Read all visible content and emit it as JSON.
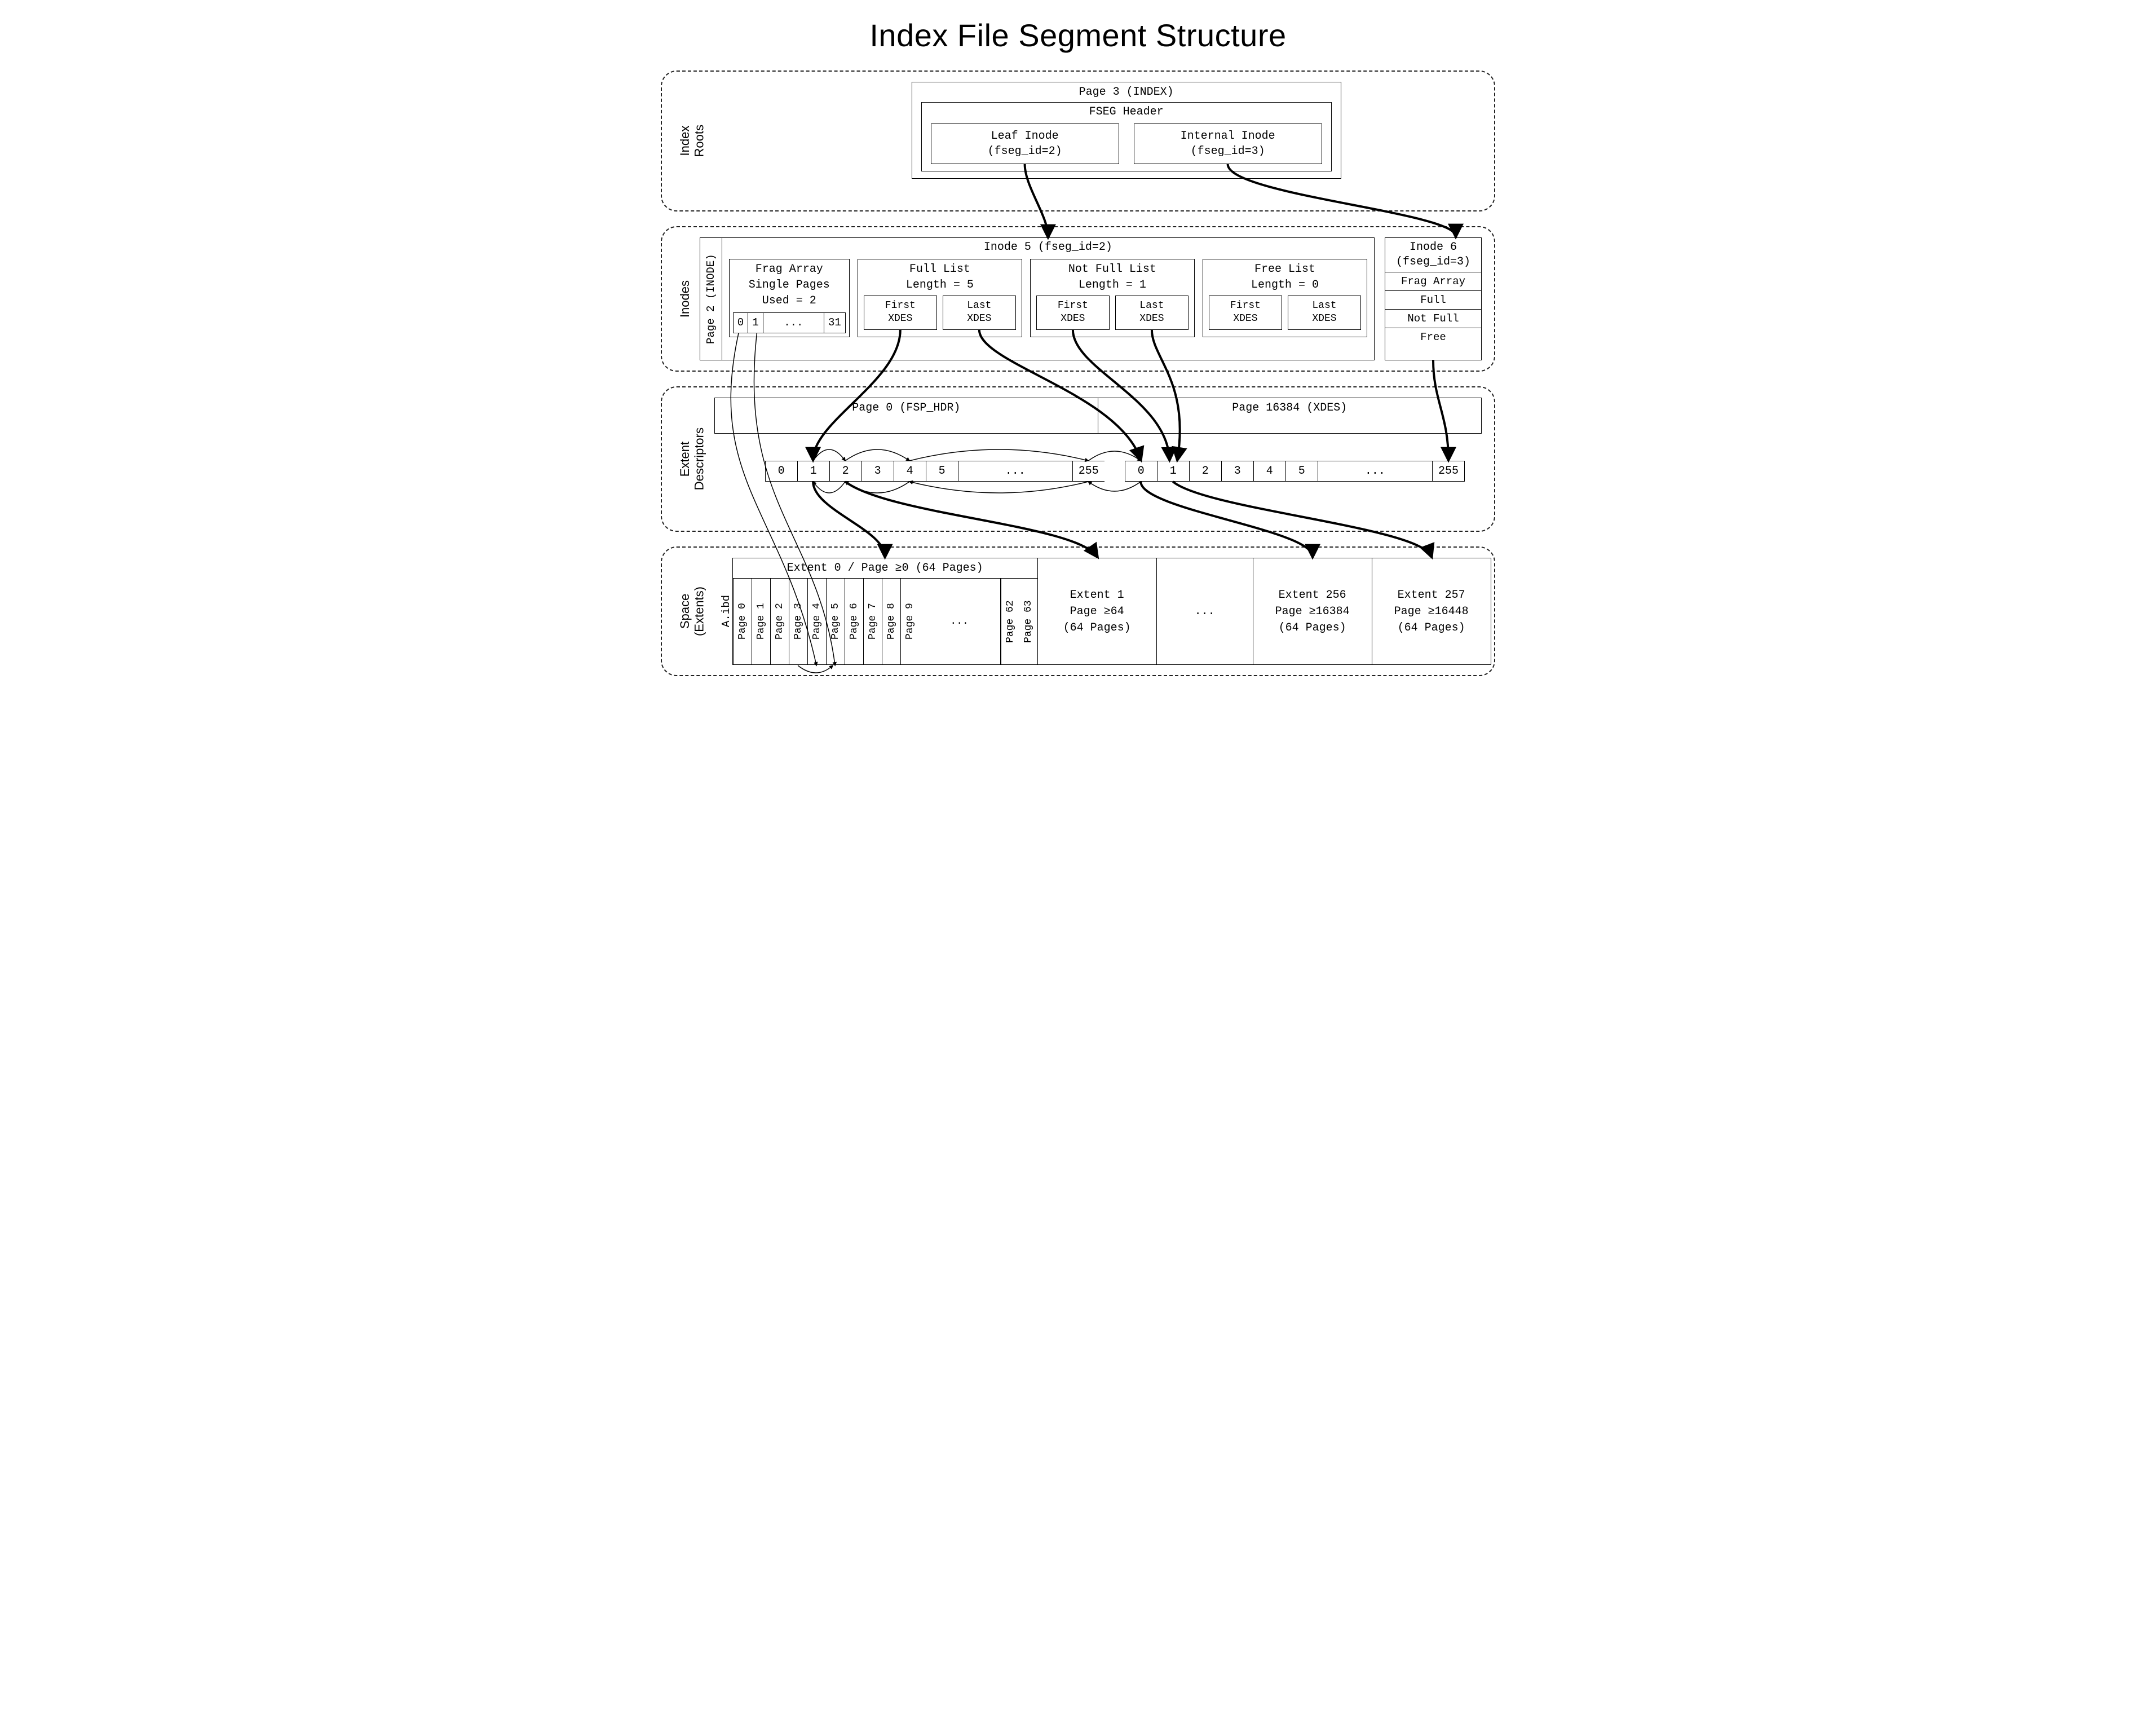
{
  "title": "Index File Segment Structure",
  "sections": {
    "index_roots": {
      "label": "Index\nRoots",
      "page3": {
        "title": "Page 3 (INDEX)",
        "fseg_header": "FSEG Header",
        "leaf_inode": "Leaf Inode\n(fseg_id=2)",
        "internal_inode": "Internal Inode\n(fseg_id=3)"
      }
    },
    "inodes": {
      "label": "Inodes",
      "page2_label": "Page 2 (INODE)",
      "inode5": {
        "title": "Inode 5 (fseg_id=2)",
        "frag_array": {
          "line1": "Frag Array",
          "line2": "Single Pages",
          "line3": "Used = 2",
          "slots": [
            "0",
            "1",
            "...",
            "31"
          ]
        },
        "full_list": {
          "title": "Full List\nLength = 5",
          "first": "First\nXDES",
          "last": "Last\nXDES"
        },
        "not_full_list": {
          "title": "Not Full List\nLength = 1",
          "first": "First\nXDES",
          "last": "Last\nXDES"
        },
        "free_list": {
          "title": "Free List\nLength = 0",
          "first": "First\nXDES",
          "last": "Last\nXDES"
        }
      },
      "inode6": {
        "title": "Inode 6\n(fseg_id=3)",
        "rows": [
          "Frag Array",
          "Full",
          "Not Full",
          "Free"
        ]
      }
    },
    "extent_descriptors": {
      "label": "Extent\nDescriptors",
      "page0": "Page 0 (FSP_HDR)",
      "page16384": "Page 16384 (XDES)",
      "slots_a": [
        "0",
        "1",
        "2",
        "3",
        "4",
        "5",
        "...",
        "255"
      ],
      "slots_b": [
        "0",
        "1",
        "2",
        "3",
        "4",
        "5",
        "...",
        "255"
      ]
    },
    "space": {
      "label": "Space\n(Extents)",
      "file": "A.ibd",
      "extent0": {
        "title": "Extent 0 / Page ≥0 (64 Pages)",
        "pages_left": [
          "Page 0",
          "Page 1",
          "Page 2",
          "Page 3",
          "Page 4",
          "Page 5",
          "Page 6",
          "Page 7",
          "Page 8",
          "Page 9"
        ],
        "ellipsis": "...",
        "pages_right": [
          "Page 62",
          "Page 63"
        ]
      },
      "extent1": "Extent 1\nPage ≥64\n(64 Pages)",
      "ellipsis": "...",
      "extent256": "Extent 256\nPage ≥16384\n(64 Pages)",
      "extent257": "Extent 257\nPage ≥16448\n(64 Pages)"
    }
  }
}
